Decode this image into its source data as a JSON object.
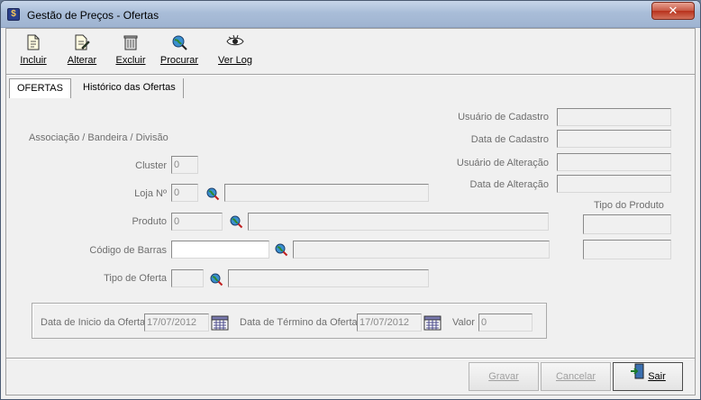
{
  "window": {
    "title": "Gestão de Preços - Ofertas",
    "close_label": "✕"
  },
  "toolbar": {
    "incluir": "Incluir",
    "alterar": "Alterar",
    "excluir": "Excluir",
    "procurar": "Procurar",
    "ver_log": "Ver Log"
  },
  "tabs": {
    "ofertas": "OFERTAS",
    "historico": "Histórico das Ofertas"
  },
  "audit": {
    "usuario_cadastro_label": "Usuário de Cadastro",
    "usuario_cadastro_value": "",
    "data_cadastro_label": "Data de Cadastro",
    "data_cadastro_value": "",
    "usuario_alteracao_label": "Usuário de Alteração",
    "usuario_alteracao_value": "",
    "data_alteracao_label": "Data de Alteração",
    "data_alteracao_value": ""
  },
  "form": {
    "assoc_label": "Associação / Bandeira / Divisão",
    "cluster_label": "Cluster",
    "cluster_value": "0",
    "loja_label": "Loja Nº",
    "loja_value": "0",
    "loja_desc": "",
    "produto_label": "Produto",
    "produto_value": "0",
    "produto_desc": "",
    "codigo_barras_label": "Código de Barras",
    "codigo_barras_value": "",
    "codigo_barras_desc": "",
    "tipo_oferta_label": "Tipo de Oferta",
    "tipo_oferta_value": "",
    "tipo_oferta_desc": "",
    "tipo_produto_label": "Tipo do Produto",
    "tipo_produto_value1": "",
    "tipo_produto_value2": ""
  },
  "period": {
    "inicio_label": "Data de Inicio da Oferta",
    "inicio_value": "17/07/2012",
    "termino_label": "Data de Término da Oferta",
    "termino_value": "17/07/2012",
    "valor_label": "Valor",
    "valor_value": "0"
  },
  "actions": {
    "gravar": "Gravar",
    "cancelar": "Cancelar",
    "sair": "Sair"
  }
}
